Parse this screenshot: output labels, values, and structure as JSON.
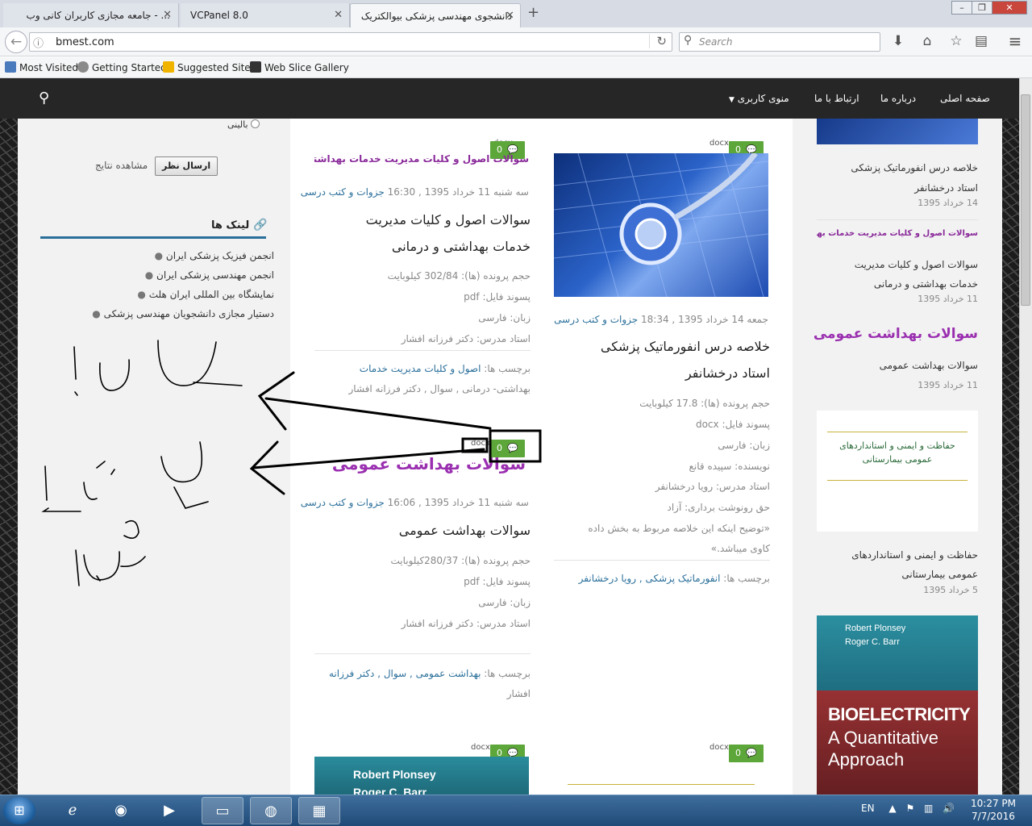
{
  "browser": {
    "tabs": [
      {
        "label": "... - جامعه مجازی کاربران کانی وب",
        "active": false
      },
      {
        "label": "VCPanel 8.0",
        "active": false
      },
      {
        "label": "دانشجوی مهندسی پزشکی بیوالکتریک",
        "active": true
      }
    ],
    "new_tab": "+",
    "url": "bmest.com",
    "search_placeholder": "Search",
    "bookmarks": [
      "Most Visited",
      "Getting Started",
      "Suggested Sites",
      "Web Slice Gallery"
    ]
  },
  "site_nav": {
    "items": [
      "صفحه اصلی",
      "درباره ما",
      "ارتباط با ما",
      "منوی کاربری"
    ]
  },
  "left_sidebar": {
    "poll_option": "بالینی",
    "poll_submit": "ارسال نظر",
    "poll_results": "مشاهده نتایج",
    "links_title": "لینک ها",
    "links": [
      "انجمن فیزیک پزشکی ایران",
      "انجمن مهندسی پزشکی ایران",
      "نمایشگاه بین المللی ایران هلث",
      "دستیار مجازی دانشجویان مهندسی پزشکی"
    ]
  },
  "posts": {
    "docx_label": "docx",
    "comment_count": "0",
    "p1": {
      "overlay_title": "سوالات اصول و کلیات مدیریت خدمات بهداشتی",
      "date": "سه شنبه 11 خرداد 1395 , 16:30",
      "category": "جزوات و کتب درسی",
      "title_l1": "سوالات اصول و کلیات مدیریت",
      "title_l2": "خدمات بهداشتی و درمانی",
      "size": "حجم پرونده (ها): 302/84 کیلوبایت",
      "filetype": "پسوند فایل: pdf",
      "lang": "زبان: فارسی",
      "teacher": "استاد مدرس: دکتر فرزانه افشار",
      "tags_label": "برچسب ها:",
      "tags_l1": "اصول و کلیات مدیریت خدمات",
      "tags_l2": "بهداشتی- درمانی , سوال , دکتر فرزانه افشار"
    },
    "p2": {
      "date": "جمعه 14 خرداد 1395 , 18:34",
      "category": "جزوات و کتب درسی",
      "title_l1": "خلاصه درس انفورماتیک پزشکی",
      "title_l2": "استاد درخشانفر",
      "size": "حجم پرونده (ها): 17.8 کیلوبایت",
      "filetype": "پسوند فایل: docx",
      "lang": "زبان: فارسی",
      "author": "نویسنده: سپیده قانع",
      "teacher": "استاد مدرس: رویا درخشانفر",
      "copy": "حق رونوشت برداری: آزاد",
      "desc_l1": "«توضیح اینکه این خلاصه مربوط به بخش داده",
      "desc_l2": "کاوی میباشد.»",
      "tags_label": "برچسب ها:",
      "tags": "انفورماتیک پزشکی , رویا درخشانفر"
    },
    "p3": {
      "overlay_title": "سوالات بهداشت عمومی",
      "date": "سه شنبه 11 خرداد 1395 , 16:06",
      "category": "جزوات و کتب درسی",
      "title": "سوالات بهداشت عمومی",
      "size": "حجم پرونده (ها): 280/37کیلوبایت",
      "filetype": "پسوند فایل: pdf",
      "lang": "زبان: فارسی",
      "teacher": "استاد مدرس: دکتر فرزانه افشار",
      "tags_label": "برچسب ها:",
      "tags_l1": "بهداشت عمومی , سوال , دکتر فرزانه",
      "tags_l2": "افشار"
    },
    "p4_book": {
      "author1": "Robert Plonsey",
      "author2": "Roger C. Barr"
    }
  },
  "right_sidebar": {
    "items": [
      {
        "title_l1": "خلاصه درس انفورماتیک پزشکی",
        "title_l2": "استاد درخشانفر",
        "date": "14 خرداد 1395"
      },
      {
        "overlay": "سوالات اصول و کلیات مدیریت خدمات بهداشتی",
        "title_l1": "سوالات اصول و کلیات مدیریت",
        "title_l2": "خدمات بهداشتی و درمانی",
        "date": "11 خرداد 1395"
      },
      {
        "overlay": "سوالات بهداشت عمومی",
        "title_l1": "سوالات بهداشت عمومی",
        "date": "11 خرداد 1395"
      },
      {
        "card_l1": "حفاظت و ایمنی و استانداردهای",
        "card_l2": "عمومی بیمارستانی",
        "title_l1": "حفاظت و ایمنی و استانداردهای",
        "title_l2": "عمومی بیمارستانی",
        "date": "5 خرداد 1395"
      }
    ],
    "book": {
      "author1": "Robert Plonsey",
      "author2": "Roger C. Barr",
      "title": "BIOELECTRICITY",
      "sub1": "A Quantitative",
      "sub2": "Approach"
    }
  },
  "taskbar": {
    "lang": "EN",
    "time": "10:27 PM",
    "date": "7/7/2016"
  }
}
